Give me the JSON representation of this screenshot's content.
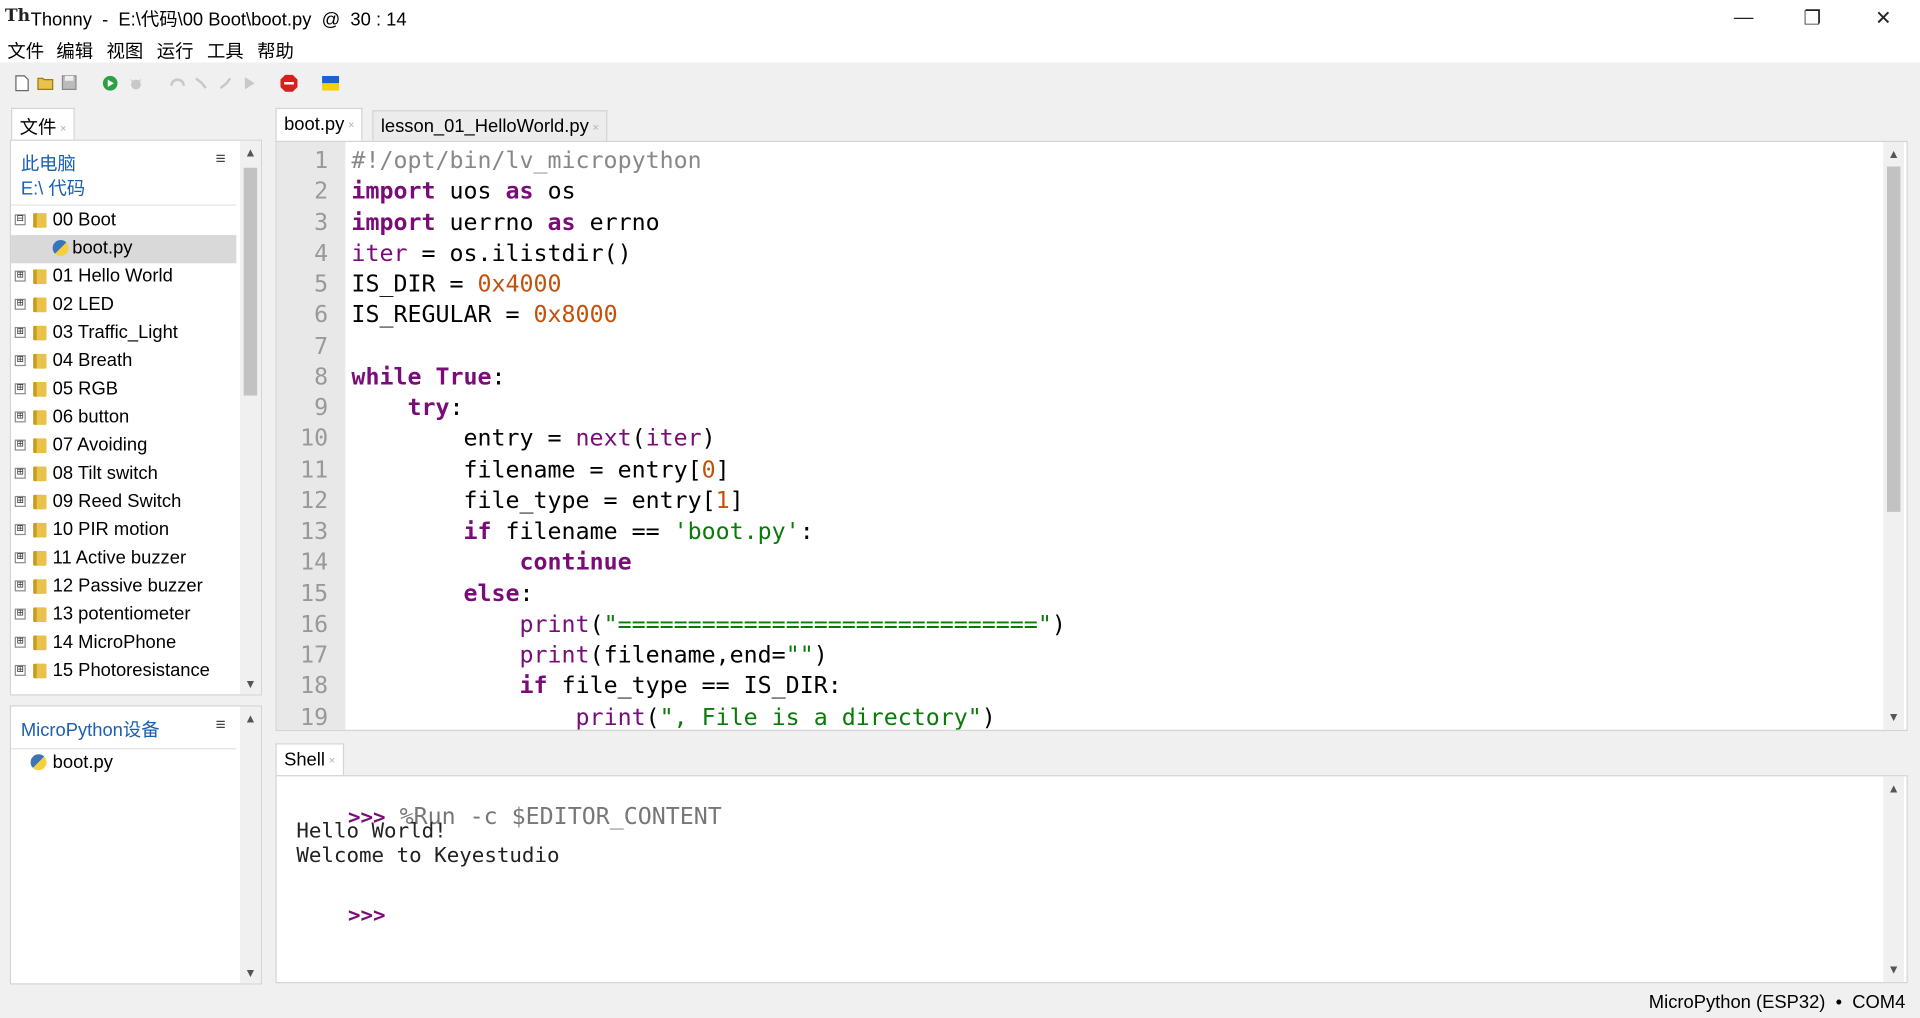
{
  "window": {
    "app_icon": "Th",
    "title": "Thonny  -  E:\\代码\\00 Boot\\boot.py  @  30 : 14",
    "minimize": "—",
    "restore": "❐",
    "close": "✕"
  },
  "menu": [
    "文件",
    "编辑",
    "视图",
    "运行",
    "工具",
    "帮助"
  ],
  "toolbar_icons": [
    "new-file-icon",
    "open-file-icon",
    "save-icon",
    "run-icon",
    "debug-icon",
    "step-over-icon",
    "step-into-icon",
    "step-out-icon",
    "resume-icon",
    "stop-icon",
    "ukraine-flag-icon"
  ],
  "files_panel": {
    "tab": "文件",
    "tab_close": "×",
    "location_line1": "此电脑",
    "location_line2": "E:\\ 代码",
    "menu_glyph": "≡",
    "items": [
      {
        "label": "00 Boot",
        "type": "folder",
        "expander": "⊟",
        "level": 0
      },
      {
        "label": "boot.py",
        "type": "python",
        "expander": "",
        "level": 1
      },
      {
        "label": "01 Hello World",
        "type": "folder",
        "expander": "⊞",
        "level": 0
      },
      {
        "label": "02 LED",
        "type": "folder",
        "expander": "⊞",
        "level": 0
      },
      {
        "label": "03 Traffic_Light",
        "type": "folder",
        "expander": "⊞",
        "level": 0
      },
      {
        "label": "04 Breath",
        "type": "folder",
        "expander": "⊞",
        "level": 0
      },
      {
        "label": "05 RGB",
        "type": "folder",
        "expander": "⊞",
        "level": 0
      },
      {
        "label": "06 button",
        "type": "folder",
        "expander": "⊞",
        "level": 0
      },
      {
        "label": "07 Avoiding",
        "type": "folder",
        "expander": "⊞",
        "level": 0
      },
      {
        "label": "08 Tilt switch",
        "type": "folder",
        "expander": "⊞",
        "level": 0
      },
      {
        "label": "09 Reed Switch",
        "type": "folder",
        "expander": "⊞",
        "level": 0
      },
      {
        "label": "10 PIR motion",
        "type": "folder",
        "expander": "⊞",
        "level": 0
      },
      {
        "label": "11 Active buzzer",
        "type": "folder",
        "expander": "⊞",
        "level": 0
      },
      {
        "label": "12 Passive buzzer",
        "type": "folder",
        "expander": "⊞",
        "level": 0
      },
      {
        "label": "13 potentiometer",
        "type": "folder",
        "expander": "⊞",
        "level": 0
      },
      {
        "label": "14 MicroPhone",
        "type": "folder",
        "expander": "⊞",
        "level": 0
      },
      {
        "label": "15 Photoresistance",
        "type": "folder",
        "expander": "⊞",
        "level": 0
      }
    ],
    "selected_index": 1
  },
  "device_panel": {
    "title": "MicroPython设备",
    "menu_glyph": "≡",
    "items": [
      {
        "label": "boot.py",
        "type": "python"
      }
    ]
  },
  "editor": {
    "tabs": [
      {
        "label": "boot.py",
        "close": "×",
        "active": true
      },
      {
        "label": "lesson_01_HelloWorld.py",
        "close": "×",
        "active": false
      }
    ],
    "line_numbers": [
      "1",
      "2",
      "3",
      "4",
      "5",
      "6",
      "7",
      "8",
      "9",
      "10",
      "11",
      "12",
      "13",
      "14",
      "15",
      "16",
      "17",
      "18",
      "19"
    ],
    "lines": [
      [
        {
          "t": "#!/opt/bin/lv_micropython",
          "c": "cm"
        }
      ],
      [
        {
          "t": "import",
          "c": "kw"
        },
        {
          "t": " uos ",
          "c": ""
        },
        {
          "t": "as",
          "c": "kw"
        },
        {
          "t": " os",
          "c": ""
        }
      ],
      [
        {
          "t": "import",
          "c": "kw"
        },
        {
          "t": " uerrno ",
          "c": ""
        },
        {
          "t": "as",
          "c": "kw"
        },
        {
          "t": " errno",
          "c": ""
        }
      ],
      [
        {
          "t": "iter",
          "c": "fn"
        },
        {
          "t": " = os.ilistdir()",
          "c": ""
        }
      ],
      [
        {
          "t": "IS_DIR = ",
          "c": ""
        },
        {
          "t": "0x4000",
          "c": "num"
        }
      ],
      [
        {
          "t": "IS_REGULAR = ",
          "c": ""
        },
        {
          "t": "0x8000",
          "c": "num"
        }
      ],
      [
        {
          "t": "",
          "c": ""
        }
      ],
      [
        {
          "t": "while",
          "c": "kw"
        },
        {
          "t": " ",
          "c": ""
        },
        {
          "t": "True",
          "c": "kw"
        },
        {
          "t": ":",
          "c": ""
        }
      ],
      [
        {
          "t": "    ",
          "c": ""
        },
        {
          "t": "try",
          "c": "kw"
        },
        {
          "t": ":",
          "c": ""
        }
      ],
      [
        {
          "t": "        entry = ",
          "c": ""
        },
        {
          "t": "next",
          "c": "fn"
        },
        {
          "t": "(",
          "c": ""
        },
        {
          "t": "iter",
          "c": "fn"
        },
        {
          "t": ")",
          "c": ""
        }
      ],
      [
        {
          "t": "        filename = entry[",
          "c": ""
        },
        {
          "t": "0",
          "c": "num"
        },
        {
          "t": "]",
          "c": ""
        }
      ],
      [
        {
          "t": "        file_type = entry[",
          "c": ""
        },
        {
          "t": "1",
          "c": "num"
        },
        {
          "t": "]",
          "c": ""
        }
      ],
      [
        {
          "t": "        ",
          "c": ""
        },
        {
          "t": "if",
          "c": "kw"
        },
        {
          "t": " filename == ",
          "c": ""
        },
        {
          "t": "'boot.py'",
          "c": "str"
        },
        {
          "t": ":",
          "c": ""
        }
      ],
      [
        {
          "t": "            ",
          "c": ""
        },
        {
          "t": "continue",
          "c": "kw"
        }
      ],
      [
        {
          "t": "        ",
          "c": ""
        },
        {
          "t": "else",
          "c": "kw"
        },
        {
          "t": ":",
          "c": ""
        }
      ],
      [
        {
          "t": "            ",
          "c": ""
        },
        {
          "t": "print",
          "c": "fn"
        },
        {
          "t": "(",
          "c": ""
        },
        {
          "t": "\"==============================\"",
          "c": "str"
        },
        {
          "t": ")",
          "c": ""
        }
      ],
      [
        {
          "t": "            ",
          "c": ""
        },
        {
          "t": "print",
          "c": "fn"
        },
        {
          "t": "(filename,end=",
          "c": ""
        },
        {
          "t": "\"\"",
          "c": "str"
        },
        {
          "t": ")",
          "c": ""
        }
      ],
      [
        {
          "t": "            ",
          "c": ""
        },
        {
          "t": "if",
          "c": "kw"
        },
        {
          "t": " file_type == IS_DIR:",
          "c": ""
        }
      ],
      [
        {
          "t": "                ",
          "c": ""
        },
        {
          "t": "print",
          "c": "fn"
        },
        {
          "t": "(",
          "c": ""
        },
        {
          "t": "\", File is a directory\"",
          "c": "str"
        },
        {
          "t": ")",
          "c": ""
        }
      ]
    ]
  },
  "shell": {
    "tab": "Shell",
    "tab_close": "×",
    "prompt": ">>>",
    "command": " %Run -c $EDITOR_CONTENT",
    "output": [
      "Hello World!",
      "Welcome to Keyestudio"
    ],
    "prompt2": ">>>"
  },
  "status": {
    "interpreter": "MicroPython (ESP32)  •  COM4"
  },
  "scroll": {
    "up": "▲",
    "down": "▼"
  },
  "colors": {
    "keyword": "#7a0c7a",
    "number": "#c4500a",
    "string": "#0a7a0a",
    "comment": "#888888",
    "link": "#1a5fb4"
  }
}
